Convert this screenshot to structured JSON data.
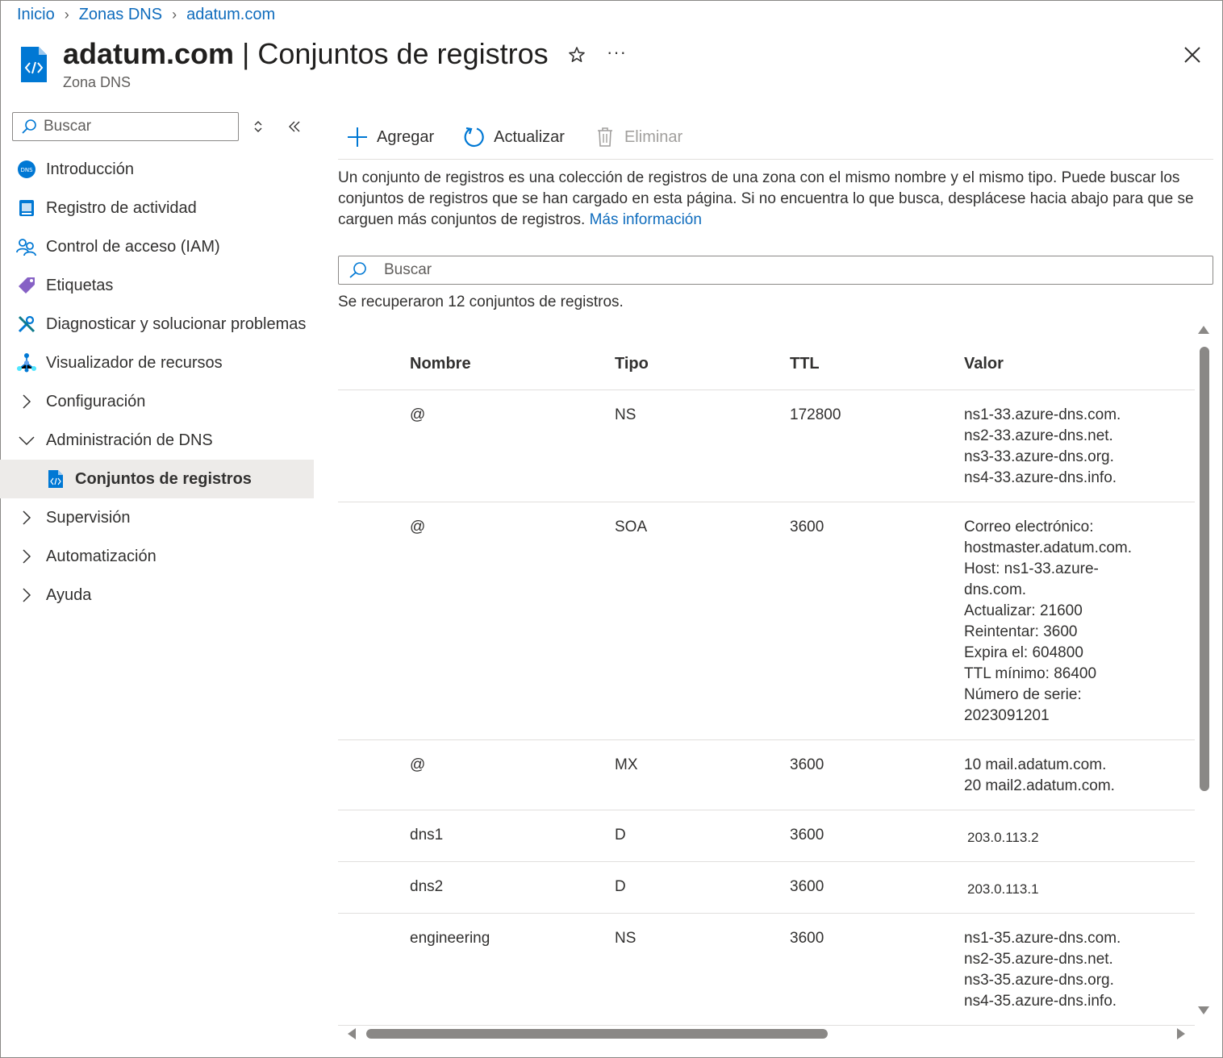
{
  "breadcrumb": [
    "Inicio",
    "Zonas DNS",
    "adatum.com"
  ],
  "header": {
    "title_bold": "adatum.com",
    "title_rest": " | Conjuntos de registros",
    "subtitle": "Zona DNS",
    "more": "···"
  },
  "nav": {
    "search_placeholder": "Buscar",
    "items": [
      {
        "label": "Introducción",
        "icon": "dns-icon"
      },
      {
        "label": "Registro de actividad",
        "icon": "activity-log-icon"
      },
      {
        "label": "Control de acceso (IAM)",
        "icon": "people-icon"
      },
      {
        "label": "Etiquetas",
        "icon": "tag-icon"
      },
      {
        "label": "Diagnosticar y solucionar problemas",
        "icon": "wrench-icon"
      },
      {
        "label": "Visualizador de recursos",
        "icon": "resource-graph-icon"
      },
      {
        "label": "Configuración",
        "icon": "chevron-right-icon"
      },
      {
        "label": "Administración de DNS",
        "icon": "chevron-down-icon"
      },
      {
        "label": "Conjuntos de registros",
        "icon": "record-set-icon"
      },
      {
        "label": "Supervisión",
        "icon": "chevron-right-icon"
      },
      {
        "label": "Automatización",
        "icon": "chevron-right-icon"
      },
      {
        "label": "Ayuda",
        "icon": "chevron-right-icon"
      }
    ]
  },
  "toolbar": {
    "add": "Agregar",
    "refresh": "Actualizar",
    "delete": "Eliminar"
  },
  "description": {
    "text": "Un conjunto de registros es una colección de registros de una zona con el mismo nombre y el mismo tipo. Puede buscar los conjuntos de registros que se han cargado en esta página. Si no encuentra lo que busca, desplácese hacia abajo para que se carguen más conjuntos de registros. ",
    "link": "Más información"
  },
  "search": {
    "placeholder": "Buscar"
  },
  "count_text": "Se recuperaron 12 conjuntos de registros.",
  "table": {
    "headers": {
      "name": "Nombre",
      "type": "Tipo",
      "ttl": "TTL",
      "value": "Valor"
    },
    "rows": [
      {
        "name": "@",
        "type": "NS",
        "ttl": "172800",
        "value": [
          "ns1-33.azure-dns.com.",
          "ns2-33.azure-dns.net.",
          "ns3-33.azure-dns.org.",
          "ns4-33.azure-dns.info."
        ]
      },
      {
        "name": "@",
        "type": "SOA",
        "ttl": "3600",
        "value": [
          "Correo electrónico:",
          "hostmaster.adatum.com.",
          "Host: ns1-33.azure-",
          "dns.com.",
          "Actualizar: 21600",
          "Reintentar: 3600",
          "Expira el: 604800",
          "TTL mínimo: 86400",
          "Número de serie:",
          "2023091201"
        ]
      },
      {
        "name": "@",
        "type": "MX",
        "ttl": "3600",
        "value": [
          "10 mail.adatum.com.",
          "20 mail2.adatum.com."
        ]
      },
      {
        "name": "dns1",
        "type": "D",
        "ttl": "3600",
        "value": [
          "203.0.113.2"
        ]
      },
      {
        "name": "dns2",
        "type": "D",
        "ttl": "3600",
        "value": [
          "203.0.113.1"
        ]
      },
      {
        "name": "engineering",
        "type": "NS",
        "ttl": "3600",
        "value": [
          "ns1-35.azure-dns.com.",
          "ns2-35.azure-dns.net.",
          "ns3-35.azure-dns.org.",
          "ns4-35.azure-dns.info."
        ]
      }
    ]
  },
  "colors": {
    "link": "#0f6cbd",
    "selected_bg": "#edebe9",
    "icon_blue": "#0078d4"
  }
}
